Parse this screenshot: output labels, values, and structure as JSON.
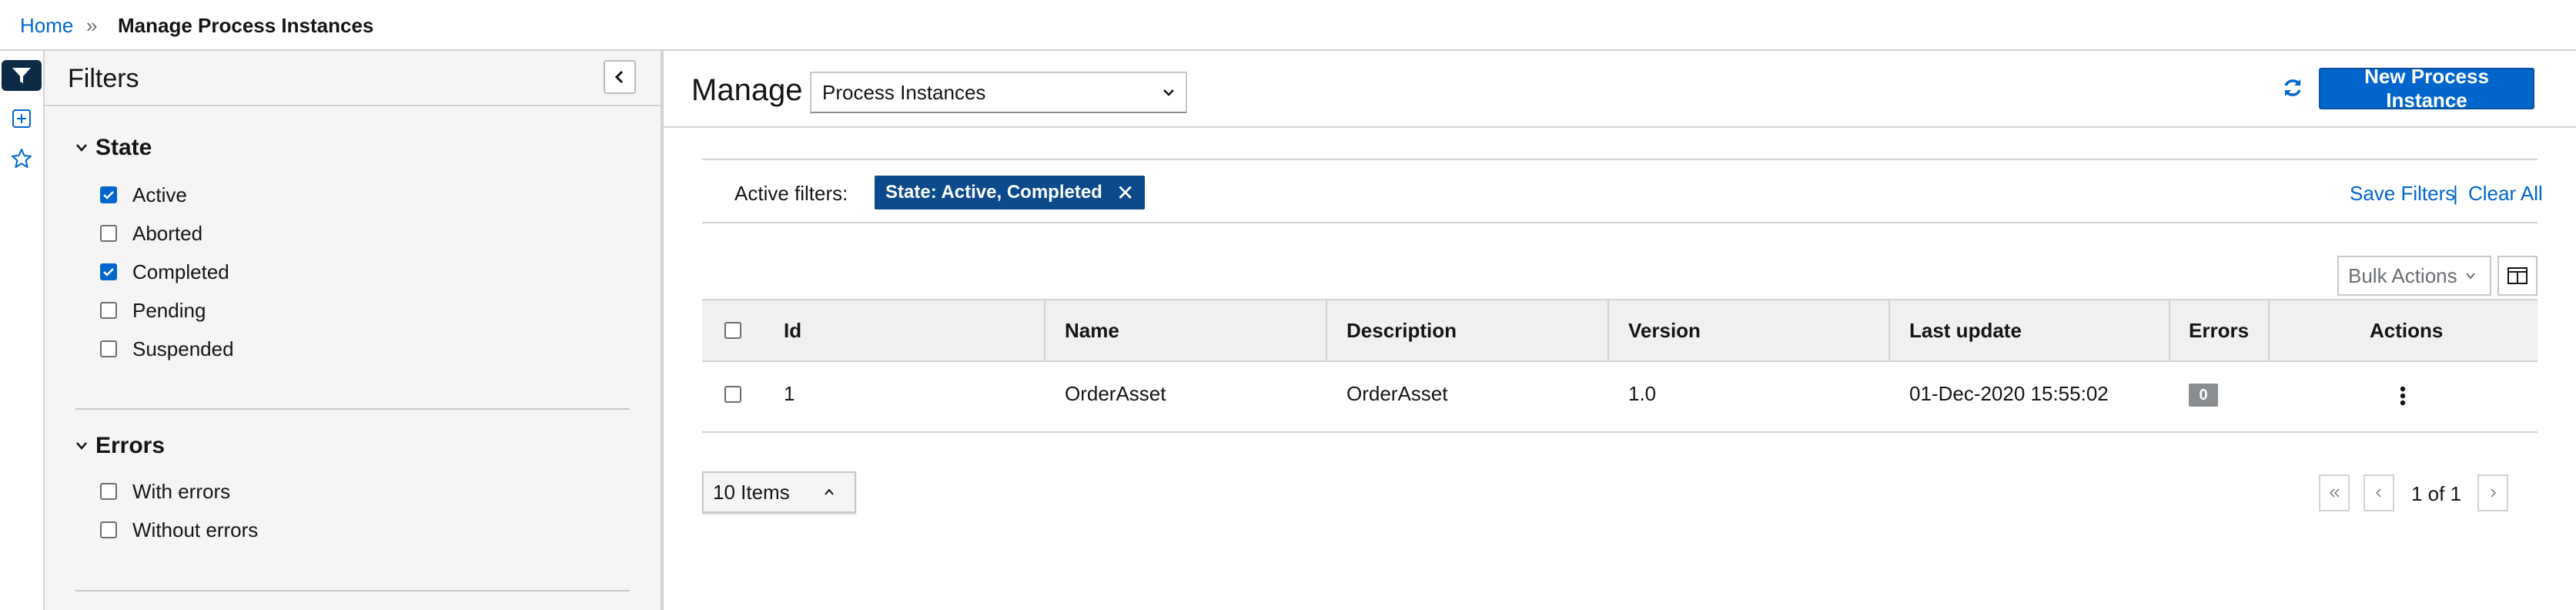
{
  "breadcrumb": {
    "home": "Home",
    "separator": "»",
    "current": "Manage Process Instances"
  },
  "filters": {
    "title": "Filters",
    "sections": [
      {
        "title": "State",
        "options": [
          {
            "label": "Active",
            "checked": true
          },
          {
            "label": "Aborted",
            "checked": false
          },
          {
            "label": "Completed",
            "checked": true
          },
          {
            "label": "Pending",
            "checked": false
          },
          {
            "label": "Suspended",
            "checked": false
          }
        ]
      },
      {
        "title": "Errors",
        "options": [
          {
            "label": "With errors",
            "checked": false
          },
          {
            "label": "Without errors",
            "checked": false
          }
        ]
      }
    ]
  },
  "main": {
    "manage_label": "Manage",
    "manage_select": "Process Instances",
    "new_button": "New Process Instance",
    "active_filters_label": "Active filters:",
    "active_filter_chip": "State: Active, Completed",
    "save_filters": "Save Filters",
    "pipe": "|",
    "clear_all": "Clear All",
    "bulk_actions": "Bulk Actions"
  },
  "table": {
    "columns": [
      "Id",
      "Name",
      "Description",
      "Version",
      "Last update",
      "Errors",
      "Actions"
    ],
    "rows": [
      {
        "id": "1",
        "name": "OrderAsset",
        "description": "OrderAsset",
        "version": "1.0",
        "last_update": "01-Dec-2020 15:55:02",
        "errors": "0"
      }
    ]
  },
  "pagination": {
    "per_page": "10 Items",
    "page_text": "1 of 1"
  },
  "colors": {
    "primary": "#0066cc",
    "chip": "#0b4a8b",
    "rail_active": "#0b2b46"
  }
}
